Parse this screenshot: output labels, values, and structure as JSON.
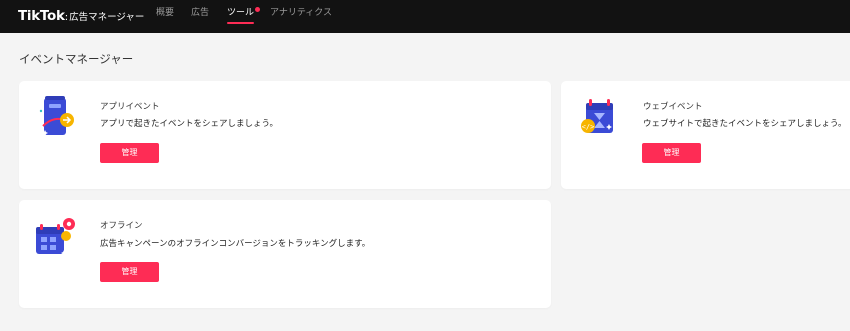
{
  "header": {
    "logo_main": "TikTok",
    "logo_colon": ":",
    "logo_sub": "広告マネージャー",
    "nav": [
      {
        "label": "概要"
      },
      {
        "label": "広告"
      },
      {
        "label": "ツール",
        "active": true,
        "has_notification_dot": true
      },
      {
        "label": "アナリティクス"
      }
    ]
  },
  "page": {
    "title": "イベントマネージャー"
  },
  "cards": [
    {
      "title": "アプリイベント",
      "description": "アプリで起きたイベントをシェアしましょう。",
      "button": "管理",
      "icon": "app-event-icon"
    },
    {
      "title": "ウェブイベント",
      "description": "ウェブサイトで起きたイベントをシェアしましょう。",
      "button": "管理",
      "icon": "web-event-icon"
    },
    {
      "title": "オフライン",
      "description": "広告キャンペーンのオフラインコンバージョンをトラッキングします。",
      "button": "管理",
      "icon": "offline-event-icon"
    }
  ],
  "colors": {
    "topbar": "#121212",
    "accent": "#fe2c55",
    "page_bg": "#f4f4f4",
    "card_bg": "#ffffff"
  }
}
